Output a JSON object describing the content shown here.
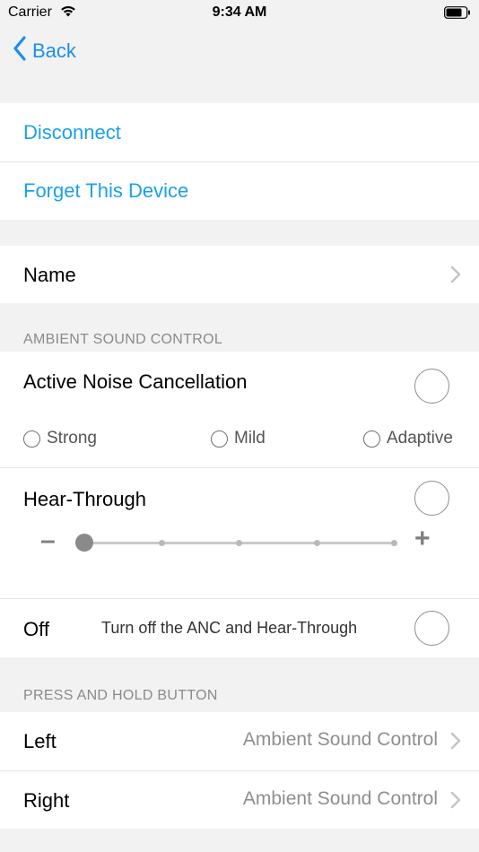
{
  "status_bar": {
    "carrier": "Carrier",
    "time": "9:34 AM",
    "wifi_icon": "wifi-icon",
    "battery_icon": "battery-icon"
  },
  "nav": {
    "back_label": "Back",
    "back_icon": "chevron-left-icon"
  },
  "connection": {
    "disconnect_label": "Disconnect",
    "forget_label": "Forget This Device"
  },
  "name_row": {
    "label": "Name"
  },
  "ambient": {
    "header": "AMBIENT SOUND CONTROL",
    "anc": {
      "label": "Active Noise Cancellation",
      "selected": false,
      "modes": [
        {
          "label": "Strong",
          "selected": false
        },
        {
          "label": "Mild",
          "selected": false
        },
        {
          "label": "Adaptive",
          "selected": false
        }
      ]
    },
    "hear_through": {
      "label": "Hear-Through",
      "selected": false,
      "minus": "–",
      "plus": "+",
      "level_index": 0,
      "level_steps": 5
    },
    "off": {
      "label": "Off",
      "description": "Turn off the ANC and Hear-Through",
      "selected": false
    }
  },
  "press_hold": {
    "header": "PRESS AND HOLD BUTTON",
    "left": {
      "label": "Left",
      "value": "Ambient Sound Control"
    },
    "right": {
      "label": "Right",
      "value": "Ambient Sound Control"
    }
  },
  "colors": {
    "accent": "#1a8ff0",
    "link": "#1ba0ea",
    "background": "#f2f2f2"
  }
}
